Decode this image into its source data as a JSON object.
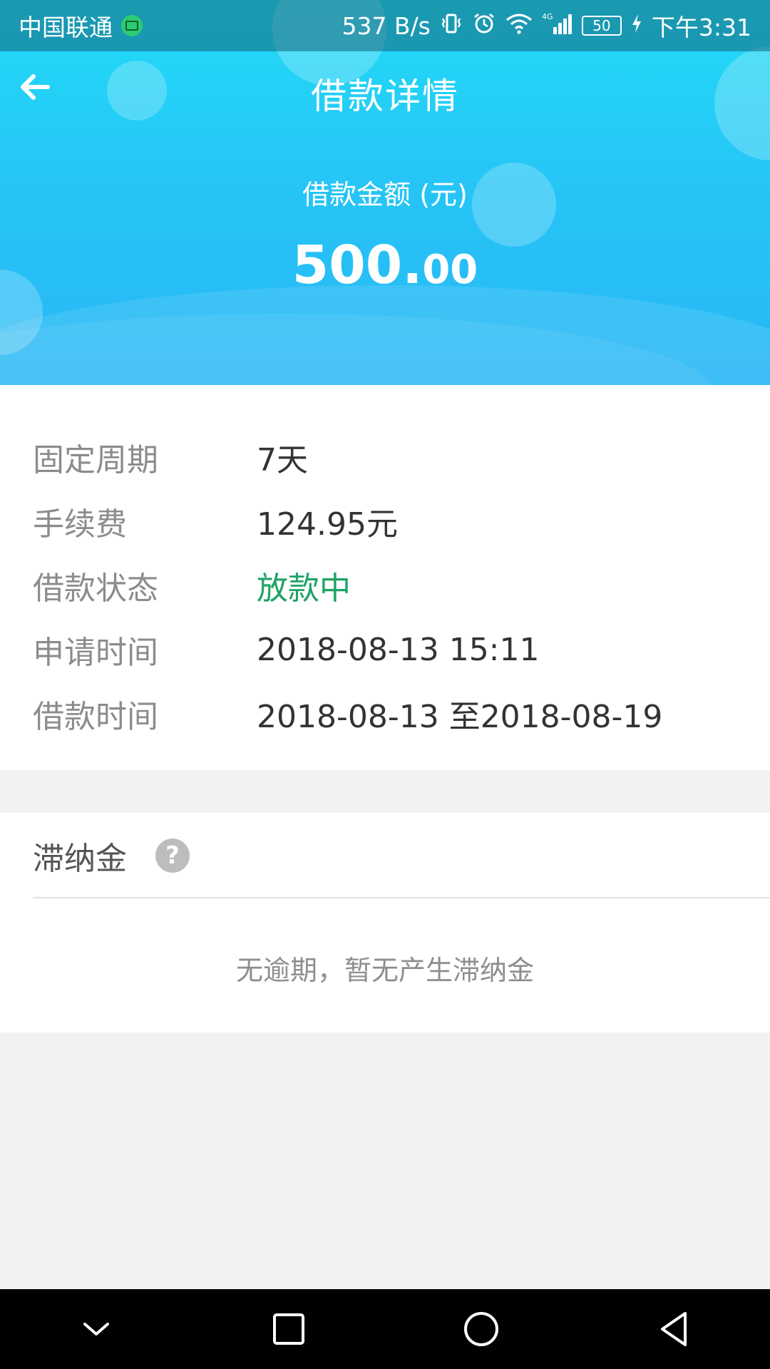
{
  "status_bar": {
    "carrier": "中国联通",
    "network_speed": "537 B/s",
    "network_type": "4G",
    "battery": "50",
    "time": "下午3:31",
    "icons": [
      "sim-icon",
      "vibrate-icon",
      "alarm-icon",
      "wifi-icon",
      "signal-icon",
      "battery-icon",
      "charging-icon"
    ]
  },
  "header": {
    "title": "借款详情",
    "back_icon": "back-arrow-icon",
    "amount_label": "借款金额 (元)",
    "amount_integer": "500.",
    "amount_decimal": "00"
  },
  "details": [
    {
      "label": "固定周期",
      "value": "7天"
    },
    {
      "label": "手续费",
      "value": "124.95元"
    },
    {
      "label": "借款状态",
      "value": "放款中"
    },
    {
      "label": "申请时间",
      "value": "2018-08-13 15:11"
    },
    {
      "label": "借款时间",
      "value": "2018-08-13 至2018-08-19"
    }
  ],
  "late_fee": {
    "title": "滞纳金",
    "help_icon": "?",
    "message": "无逾期，暂无产生滞纳金"
  },
  "nav_bar": {
    "icons": [
      "hide-keyboard-icon",
      "recents-icon",
      "home-icon",
      "back-icon"
    ]
  },
  "colors": {
    "header_gradient_top": "#21dcf7",
    "header_gradient_bottom": "#29b6f5",
    "status_green": "#1ea364",
    "label_gray": "#8c8c8c",
    "value_dark": "#333333"
  }
}
